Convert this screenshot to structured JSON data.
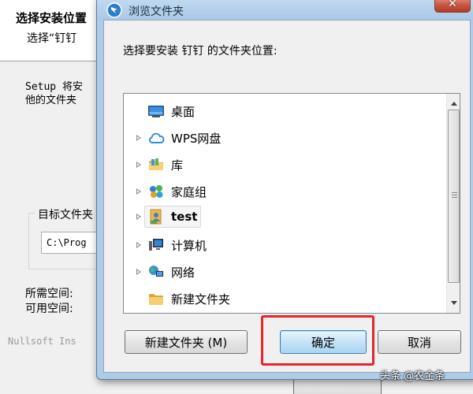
{
  "installer": {
    "title": "选择安装位置",
    "subtitle": "选择“钉钉",
    "desc_line1": "Setup 将安",
    "desc_line2": "他的文件夹",
    "group_label": "目标文件夹",
    "path": "C:\\Prog",
    "space_required": "所需空间:",
    "space_available": "可用空间:",
    "brand": "Nullsoft Ins"
  },
  "dialog": {
    "title": "浏览文件夹",
    "close_glyph": "✕",
    "prompt": "选择要安装 钉钉 的文件夹位置:",
    "tree": [
      {
        "label": "桌面",
        "icon": "desktop-icon",
        "expander": false
      },
      {
        "label": "WPS网盘",
        "icon": "cloud-icon",
        "expander": true
      },
      {
        "label": "库",
        "icon": "library-icon",
        "expander": true
      },
      {
        "label": "家庭组",
        "icon": "homegroup-icon",
        "expander": true
      },
      {
        "label": "test",
        "icon": "user-folder-icon",
        "expander": true,
        "selected": true
      },
      {
        "label": "计算机",
        "icon": "computer-icon",
        "expander": true
      },
      {
        "label": "网络",
        "icon": "network-icon",
        "expander": true
      },
      {
        "label": "新建文件夹",
        "icon": "folder-icon",
        "expander": false
      }
    ],
    "buttons": {
      "new_folder": "新建文件夹 (M)",
      "ok": "确定",
      "cancel": "取消"
    }
  },
  "watermark": "头条 @农金条",
  "colors": {
    "highlight": "#e4262c",
    "titlebar": "#aecbe8",
    "close": "#c75844"
  }
}
